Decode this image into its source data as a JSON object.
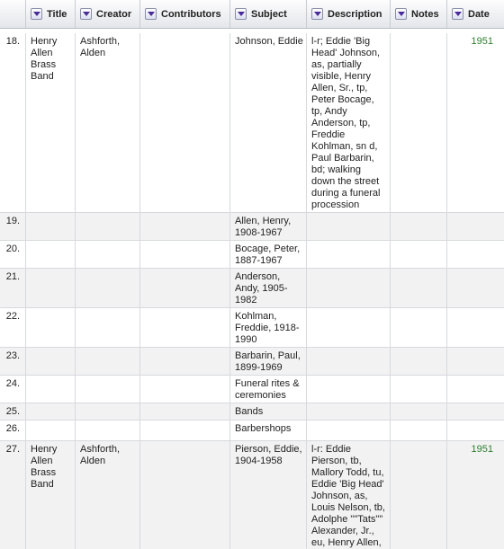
{
  "columns": [
    {
      "key": "title",
      "label": "Title"
    },
    {
      "key": "creator",
      "label": "Creator"
    },
    {
      "key": "contributors",
      "label": "Contributors"
    },
    {
      "key": "subject",
      "label": "Subject"
    },
    {
      "key": "description",
      "label": "Description"
    },
    {
      "key": "notes",
      "label": "Notes"
    },
    {
      "key": "date",
      "label": "Date"
    }
  ],
  "rows": [
    {
      "num": "18.",
      "title": "Henry Allen Brass Band",
      "creator": "Ashforth, Alden",
      "contributors": "",
      "subject": "Johnson, Eddie",
      "description": "l-r; Eddie 'Big Head' Johnson, as, partially visible, Henry Allen, Sr., tp, Peter Bocage, tp, Andy Anderson, tp, Freddie Kohlman, sn d, Paul Barbarin, bd; walking down the street during a funeral procession",
      "notes": "",
      "date": "1951"
    },
    {
      "num": "19.",
      "title": "",
      "creator": "",
      "contributors": "",
      "subject": "Allen, Henry, 1908-1967",
      "description": "",
      "notes": "",
      "date": ""
    },
    {
      "num": "20.",
      "title": "",
      "creator": "",
      "contributors": "",
      "subject": "Bocage, Peter, 1887-1967",
      "description": "",
      "notes": "",
      "date": ""
    },
    {
      "num": "21.",
      "title": "",
      "creator": "",
      "contributors": "",
      "subject": "Anderson, Andy, 1905-1982",
      "description": "",
      "notes": "",
      "date": ""
    },
    {
      "num": "22.",
      "title": "",
      "creator": "",
      "contributors": "",
      "subject": "Kohlman, Freddie, 1918-1990",
      "description": "",
      "notes": "",
      "date": ""
    },
    {
      "num": "23.",
      "title": "",
      "creator": "",
      "contributors": "",
      "subject": "Barbarin, Paul, 1899-1969",
      "description": "",
      "notes": "",
      "date": ""
    },
    {
      "num": "24.",
      "title": "",
      "creator": "",
      "contributors": "",
      "subject": "Funeral rites & ceremonies",
      "description": "",
      "notes": "",
      "date": ""
    },
    {
      "num": "25.",
      "title": "",
      "creator": "",
      "contributors": "",
      "subject": "Bands",
      "description": "",
      "notes": "",
      "date": ""
    },
    {
      "num": "26.",
      "title": "",
      "creator": "",
      "contributors": "",
      "subject": "Barbershops",
      "description": "",
      "notes": "",
      "date": ""
    },
    {
      "num": "27.",
      "title": "Henry Allen Brass Band",
      "creator": "Ashforth, Alden",
      "contributors": "",
      "subject": "Pierson, Eddie, 1904-1958",
      "description": "l-r: Eddie Pierson, tb, Mallory Todd, tu, Eddie 'Big Head' Johnson, as, Louis Nelson, tb, Adolphe \"\"Tats\"\" Alexander, Jr., eu, Henry Allen,",
      "notes": "",
      "date": "1951"
    }
  ]
}
